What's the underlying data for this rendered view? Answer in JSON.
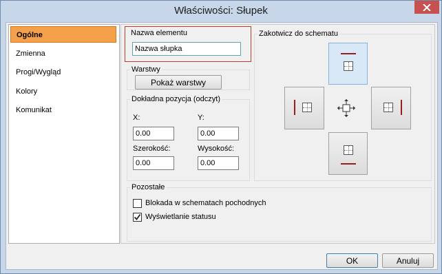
{
  "window": {
    "title": "Właściwości: Słupek"
  },
  "sidebar": {
    "items": [
      {
        "label": "Ogólne",
        "selected": true
      },
      {
        "label": "Zmienna"
      },
      {
        "label": "Progi/Wygląd"
      },
      {
        "label": "Kolory"
      },
      {
        "label": "Komunikat"
      }
    ]
  },
  "element_name": {
    "legend": "Nazwa elementu",
    "value": "Nazwa słupka"
  },
  "layers": {
    "legend": "Warstwy",
    "button_label": "Pokaż warstwy"
  },
  "position": {
    "legend": "Dokładna pozycja (odczyt)",
    "x_label": "X:",
    "x_value": "0.00",
    "y_label": "Y:",
    "y_value": "0.00",
    "width_label": "Szerokość:",
    "width_value": "0.00",
    "height_label": "Wysokość:",
    "height_value": "0.00"
  },
  "anchor": {
    "legend": "Zakotwicz do schematu"
  },
  "other": {
    "legend": "Pozostałe",
    "lock_label": "Blokada w schematach pochodnych",
    "lock_checked": false,
    "status_label": "Wyświetlanie statusu",
    "status_checked": true
  },
  "footer": {
    "ok_label": "OK",
    "cancel_label": "Anuluj"
  },
  "colors": {
    "selected_item": "#f5a04a",
    "highlight_border": "#c0392b",
    "anchor_bar": "#9b1c1c"
  }
}
